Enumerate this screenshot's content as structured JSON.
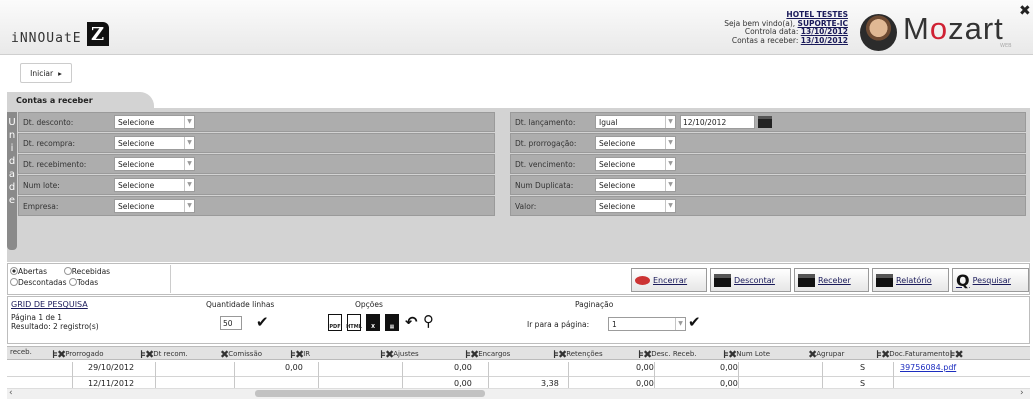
{
  "brand": {
    "left_logo": "iNNOUatE",
    "left_logo_mark": "Z",
    "right_logo": "Mozart",
    "right_logo_sub": "WEB"
  },
  "header": {
    "hotel": "HOTEL TESTES",
    "welcome_prefix": "Seja bem vindo(a),",
    "user": "SUPORTE-IC",
    "control_date_label": "Controla data:",
    "control_date": "13/10/2012",
    "receivable_label": "Contas a receber:",
    "receivable_date": "13/10/2012"
  },
  "nav": {
    "start_button": "Iniciar"
  },
  "page": {
    "tab_title": "Contas a receber",
    "side_label": "Unidade"
  },
  "filters": {
    "left": [
      {
        "label": "Dt. desconto:",
        "value": "Selecione"
      },
      {
        "label": "Dt. recompra:",
        "value": "Selecione"
      },
      {
        "label": "Dt. recebimento:",
        "value": "Selecione"
      },
      {
        "label": "Num lote:",
        "value": "Selecione"
      },
      {
        "label": "Empresa:",
        "value": "Selecione"
      }
    ],
    "right": [
      {
        "label": "Dt. lançamento:",
        "value": "Igual",
        "date": "12/10/2012"
      },
      {
        "label": "Dt. prorrogação:",
        "value": "Selecione"
      },
      {
        "label": "Dt. vencimento:",
        "value": "Selecione"
      },
      {
        "label": "Num Duplicata:",
        "value": "Selecione"
      },
      {
        "label": "Valor:",
        "value": "Selecione"
      }
    ]
  },
  "status_options": [
    {
      "label": "Abertas",
      "checked": true
    },
    {
      "label": "Recebidas",
      "checked": false
    },
    {
      "label": "Descontadas",
      "checked": false
    },
    {
      "label": "Todas",
      "checked": false
    }
  ],
  "actions": [
    "Encerrar",
    "Descontar",
    "Receber",
    "Relatório",
    "Pesquisar"
  ],
  "grid": {
    "title": "GRID DE PESQUISA",
    "page_info": "Página 1 de 1",
    "result_info": "Resultado: 2 registro(s)",
    "qty_label": "Quantidade linhas",
    "qty_value": "50",
    "options_label": "Opções",
    "pagination_label": "Paginação",
    "goto_label": "Ir para a página:",
    "goto_value": "1",
    "columns": [
      "receb.",
      "Prorrogado",
      "Dt recom.",
      "Comissão",
      "IR",
      "Ajustes",
      "Encargos",
      "Retenções",
      "Desc. Receb.",
      "Num Lote",
      "Agrupar",
      "Doc.Faturamento"
    ],
    "rows": [
      {
        "prorrogado": "29/10/2012",
        "comissao": "0,00",
        "ajustes": "0,00",
        "retencoes": "0,00",
        "desc_receb": "0,00",
        "agrupar": "S",
        "doc": "39756084.pdf"
      },
      {
        "prorrogado": "12/11/2012",
        "ajustes": "0,00",
        "encargos": "3,38",
        "retencoes": "0,00",
        "desc_receb": "0,00",
        "agrupar": "S",
        "doc": ""
      }
    ]
  }
}
